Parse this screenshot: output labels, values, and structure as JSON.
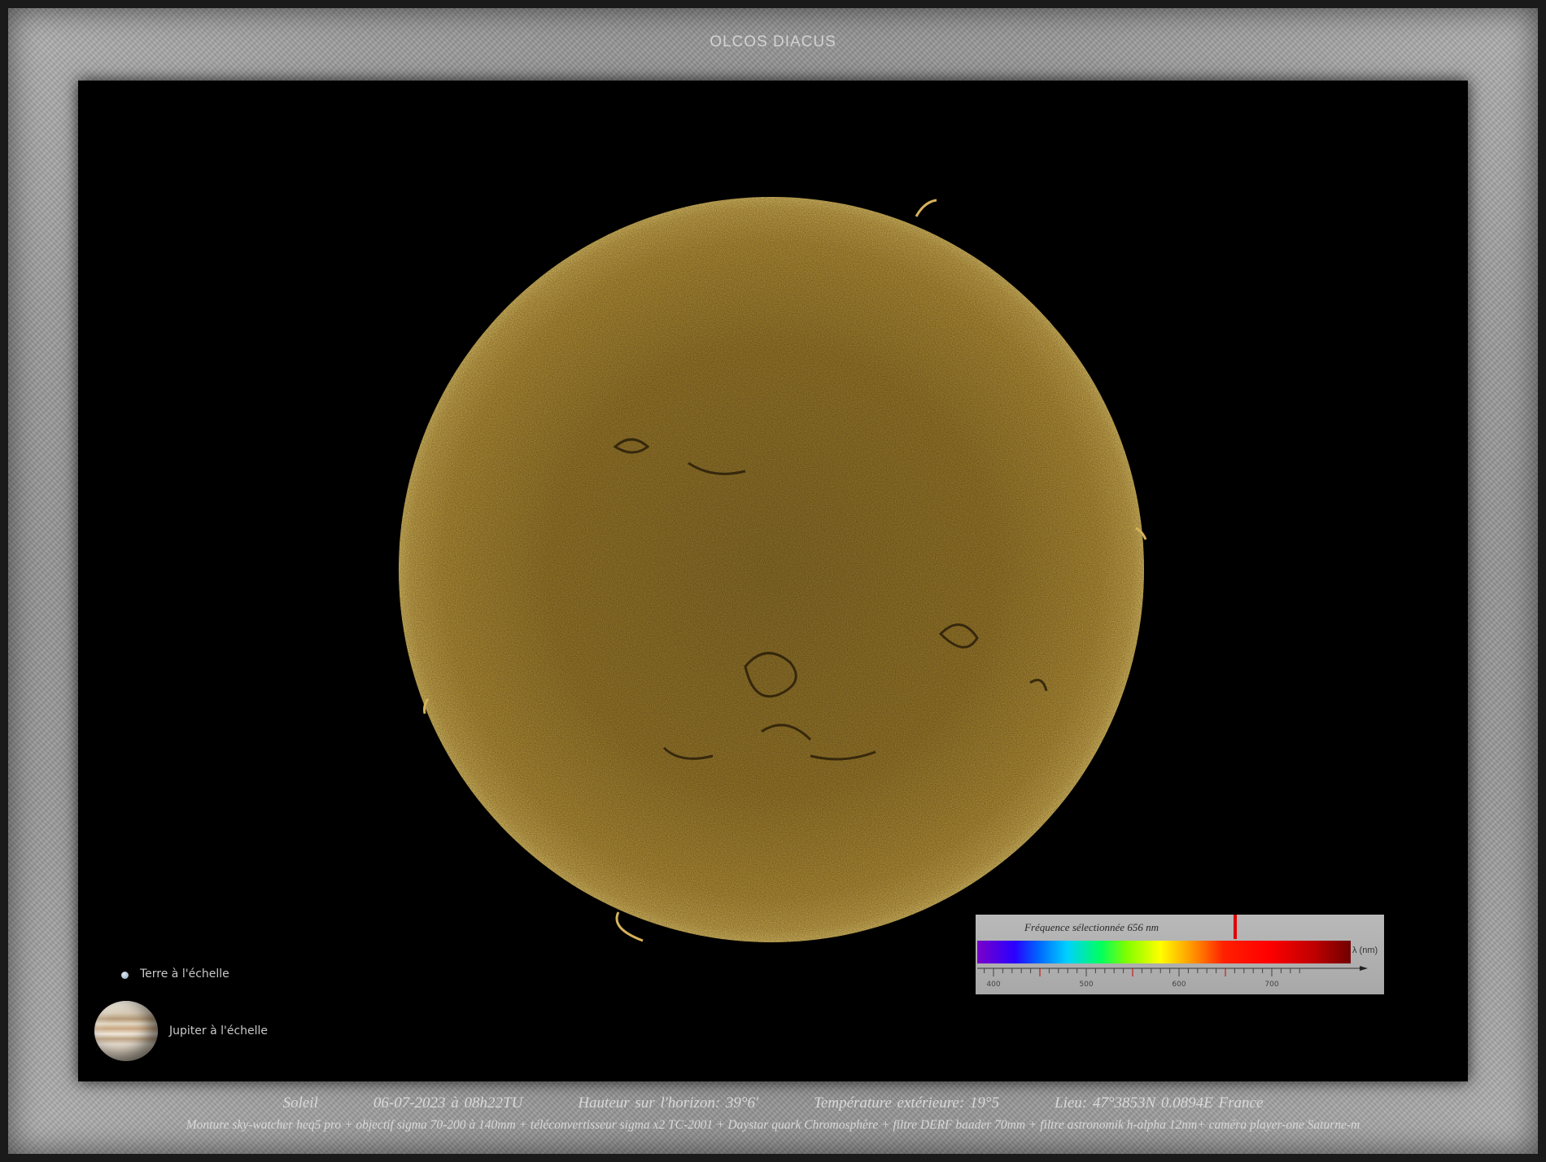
{
  "title": "OLCOS DIACUS",
  "legend": {
    "earth_label": "Terre à l'échelle",
    "jupiter_label": "Jupiter à l'échelle"
  },
  "spectrum": {
    "label": "Fréquence sélectionnée 656 nm",
    "unit": "λ (nm)",
    "ticks": [
      "400",
      "500",
      "600",
      "700"
    ],
    "selected_nm": 656
  },
  "info": {
    "object": "Soleil",
    "datetime": "06-07-2023  à  08h22TU",
    "altitude": "Hauteur sur l'horizon: 39°6'",
    "temperature": "Température extérieure: 19°5",
    "location": "Lieu: 47°3853N      0.0894E      France"
  },
  "equipment": "Monture sky-watcher heq5 pro  +  objectif sigma  70-200 à 140mm  +  téléconvertisseur sigma x2 TC-2001 +  Daystar quark Chromosphère  +  filtre DERF baader 70mm + filtre astronomik h-alpha 12nm+  caméra player-one Saturne-m",
  "colors": {
    "sun_base": "#a8842e",
    "sun_bright": "#d4ab45",
    "background": "#000000"
  }
}
